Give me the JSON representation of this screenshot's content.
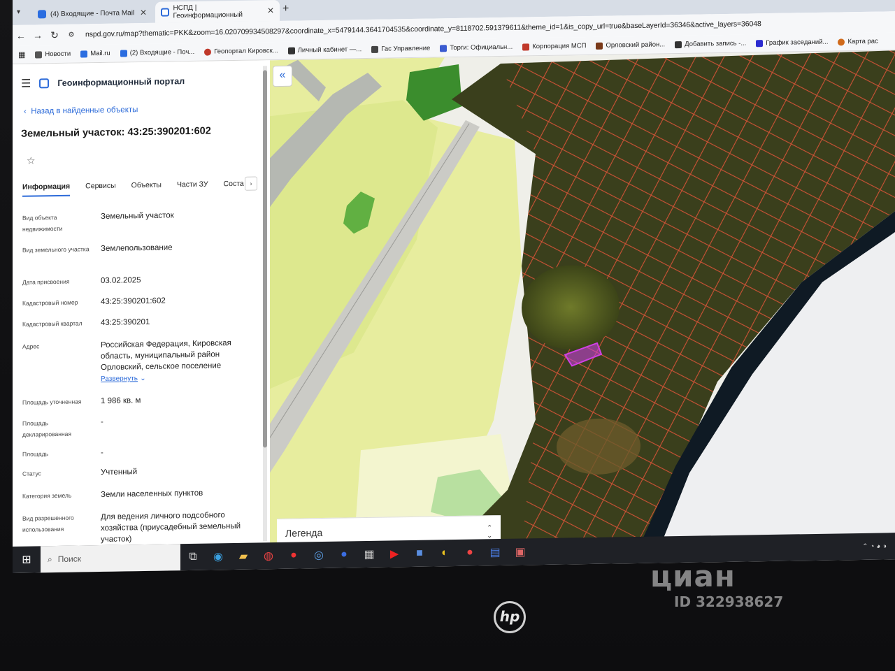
{
  "browser": {
    "tabs": [
      {
        "label": "(4) Входящие - Почта Mail"
      },
      {
        "label": "НСПД | Геоинформационный"
      }
    ],
    "url": "nspd.gov.ru/map?thematic=PKK&zoom=16.020709934508297&coordinate_x=5479144.3641704535&coordinate_y=8118702.591379611&theme_id=1&is_copy_url=true&baseLayerId=36346&active_layers=36048",
    "bookmarks": [
      "Новости",
      "Mail.ru",
      "(2) Входящие - Поч...",
      "Геопортал Кировск...",
      "Личный кабинет —...",
      "Гас Управление",
      "Торги: Официальн...",
      "Корпорация МСП",
      "Орловский район...",
      "Добавить запись -...",
      "График заседаний...",
      "Карта рас"
    ]
  },
  "panel": {
    "portal_title": "Геоинформационный портал",
    "back_link": "Назад в найденные объекты",
    "title": "Земельный участок: 43:25:390201:602",
    "tabs": [
      "Информация",
      "Сервисы",
      "Объекты",
      "Части ЗУ",
      "Соста"
    ],
    "rows": [
      {
        "label": "Вид объекта недвижимости",
        "value": "Земельный участок"
      },
      {
        "label": "Вид земельного участка",
        "value": "Землепользование"
      },
      {
        "label": "Дата присвоения",
        "value": "03.02.2025"
      },
      {
        "label": "Кадастровый номер",
        "value": "43:25:390201:602"
      },
      {
        "label": "Кадастровый квартал",
        "value": "43:25:390201"
      },
      {
        "label": "Адрес",
        "value": "Российская Федерация, Кировская область, муниципальный район Орловский, сельское поселение",
        "more": "Развернуть"
      },
      {
        "label": "Площадь уточненная",
        "value": "1 986 кв. м"
      },
      {
        "label": "Площадь декларированная",
        "value": "-"
      },
      {
        "label": "Площадь",
        "value": "-"
      },
      {
        "label": "Статус",
        "value": "Учтенный"
      },
      {
        "label": "Категория земель",
        "value": "Земли населенных пунктов"
      },
      {
        "label": "Вид разрешенного использования",
        "value": "Для ведения личного подсобного хозяйства (приусадебный земельный участок)"
      }
    ]
  },
  "map": {
    "legend": "Легенда"
  },
  "taskbar": {
    "search_placeholder": "Поиск"
  },
  "monitor": {
    "brand": "hp",
    "watermark": "циан",
    "watermark_id": "ID 322938627"
  }
}
